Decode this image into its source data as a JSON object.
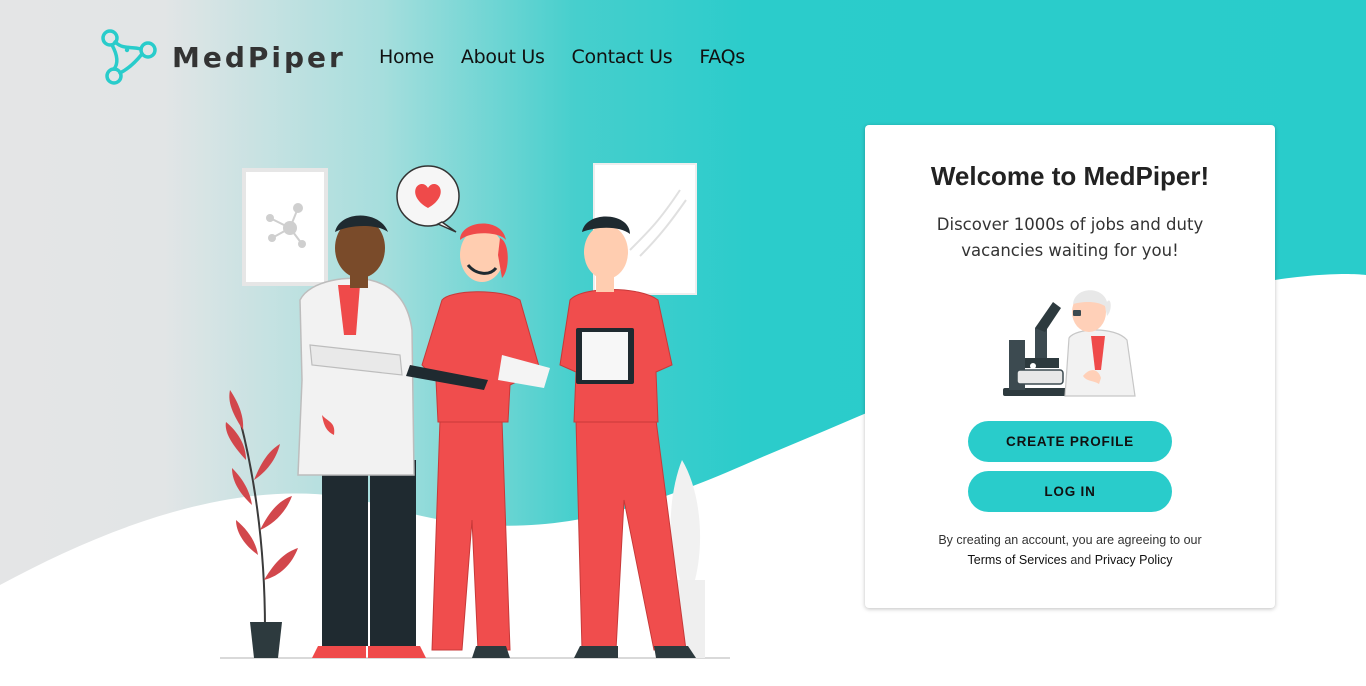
{
  "brand": {
    "name": "MedPiper",
    "accent_color": "#29cccb"
  },
  "nav": {
    "items": [
      "Home",
      "About Us",
      "Contact Us",
      "FAQs"
    ]
  },
  "card": {
    "title": "Welcome to MedPiper!",
    "subtitle": "Discover 1000s of jobs and duty vacancies waiting for you!",
    "create_profile_label": "CREATE PROFILE",
    "login_label": "LOG IN",
    "legal_prefix": "By creating an account, you are agreeing to our",
    "terms_label": "Terms of Services",
    "legal_conjunction": "and",
    "privacy_label": "Privacy Policy"
  },
  "icons": [
    "molecule-logo-icon",
    "heart-icon",
    "microscope-icon"
  ]
}
